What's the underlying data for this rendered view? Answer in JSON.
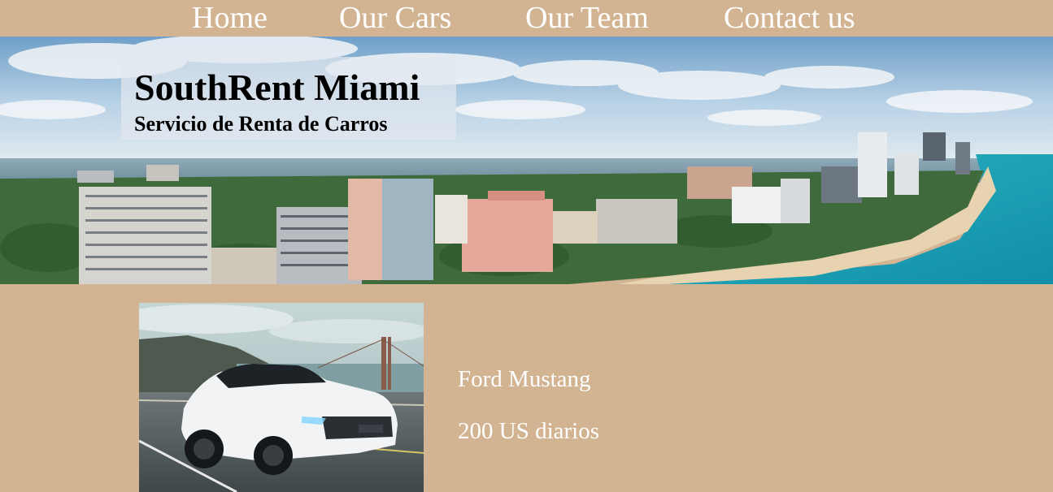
{
  "nav": {
    "items": [
      {
        "label": "Home"
      },
      {
        "label": "Our Cars"
      },
      {
        "label": "Our Team"
      },
      {
        "label": "Contact us"
      }
    ]
  },
  "hero": {
    "title": "SouthRent Miami",
    "subtitle": "Servicio de Renta de Carros"
  },
  "car": {
    "name": "Ford Mustang",
    "price": "200 US diarios"
  },
  "colors": {
    "background": "#d2b493",
    "nav_text": "#ffffff",
    "title_text": "#000000"
  }
}
